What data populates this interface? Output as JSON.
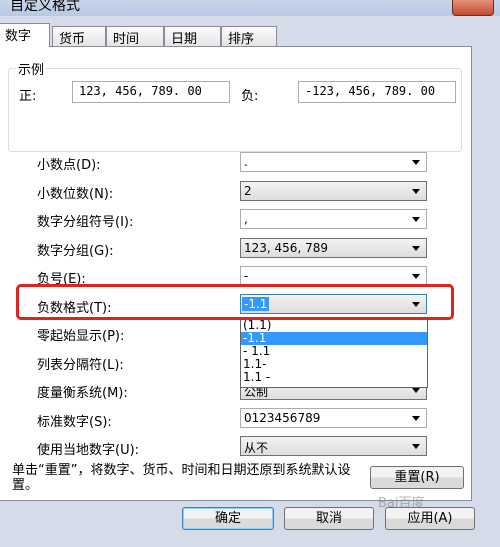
{
  "window": {
    "title": "自定义格式"
  },
  "tabs": [
    "数字",
    "货币",
    "时间",
    "日期",
    "排序"
  ],
  "sample": {
    "legend": "示例",
    "positive_label": "正:",
    "positive_value": "123, 456, 789. 00",
    "negative_label": "负:",
    "negative_value": "-123, 456, 789. 00"
  },
  "settings": [
    {
      "label": "小数点(D):",
      "value": "."
    },
    {
      "label": "小数位数(N):",
      "value": "2"
    },
    {
      "label": "数字分组符号(I):",
      "value": ","
    },
    {
      "label": "数字分组(G):",
      "value": "123, 456, 789"
    },
    {
      "label": "负号(E):",
      "value": "-"
    },
    {
      "label": "负数格式(T):",
      "value": "-1.1"
    },
    {
      "label": "零起始显示(P):",
      "value": ""
    },
    {
      "label": "列表分隔符(L):",
      "value": ""
    },
    {
      "label": "度量衡系统(M):",
      "value": "公制"
    },
    {
      "label": "标准数字(S):",
      "value": "0123456789"
    },
    {
      "label": "使用当地数字(U):",
      "value": "从不"
    }
  ],
  "negative_format_options": [
    "(1.1)",
    "-1.1",
    "- 1.1",
    "1.1-",
    "1.1 -"
  ],
  "negative_format_selected_index": 1,
  "reset_note": "单击“重置”，将数字、货币、时间和日期还原到系统默认设置。",
  "buttons": {
    "reset": "重置(R)",
    "ok": "确定",
    "cancel": "取消",
    "apply": "应用(A)"
  },
  "colors": {
    "highlight": "#e0231c",
    "selection": "#3399ff"
  }
}
